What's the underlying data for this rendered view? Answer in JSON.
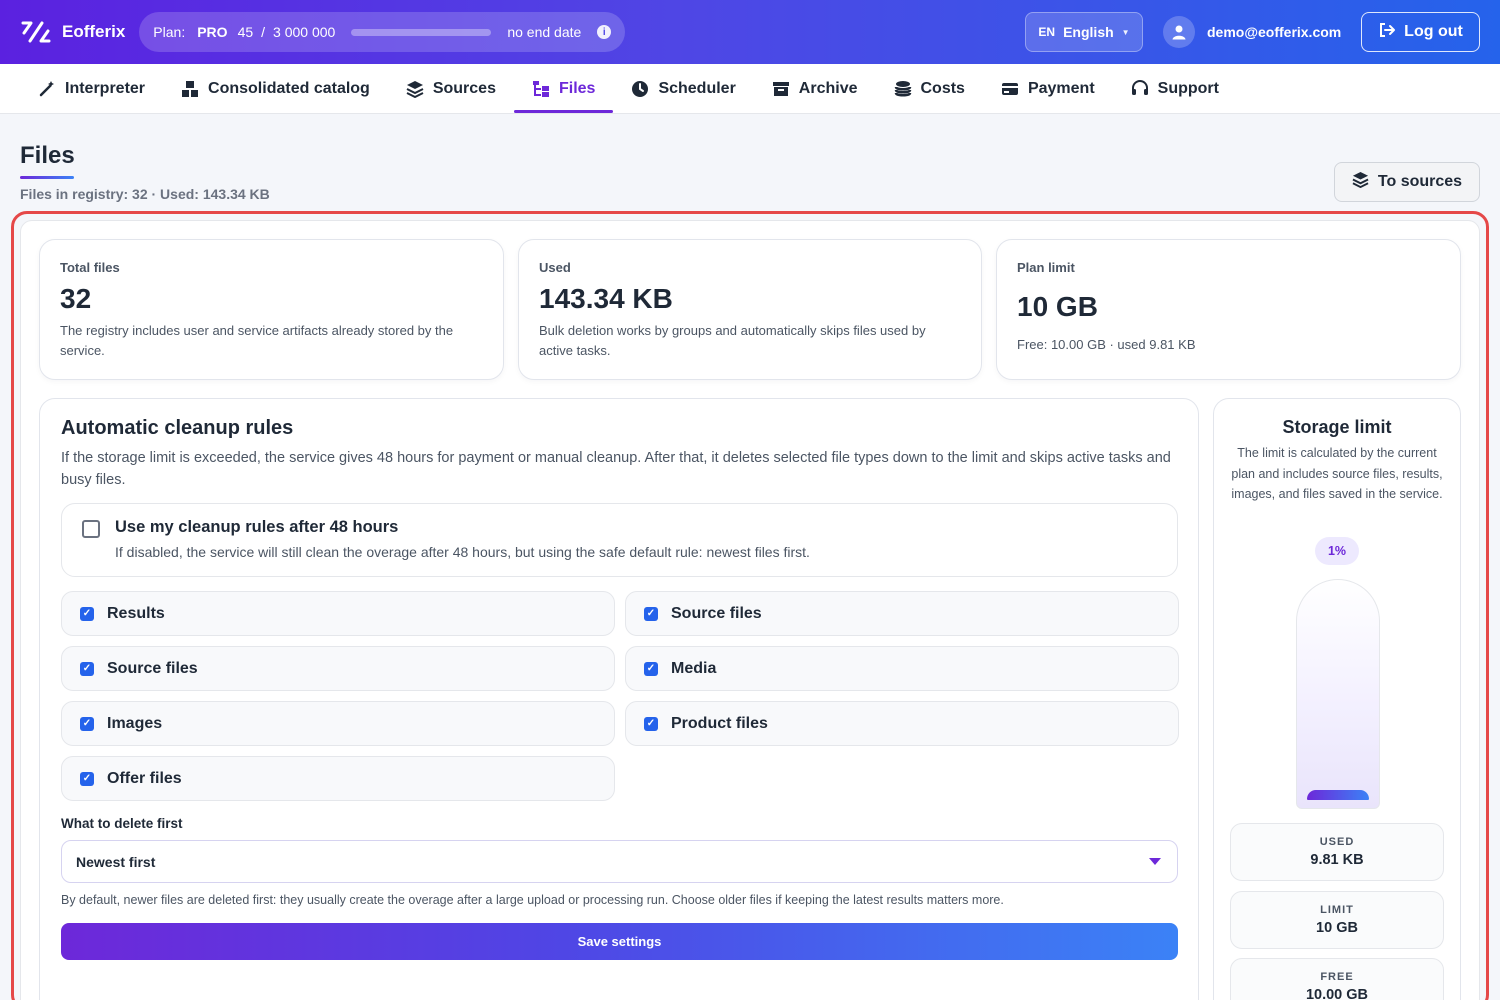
{
  "app": {
    "name": "Eofferix"
  },
  "plan": {
    "label": "Plan:",
    "tier": "PRO",
    "used": "45",
    "separator": "/",
    "limit": "3 000 000",
    "usage_fraction": 1.5e-05,
    "end": "no end date"
  },
  "language": {
    "code": "EN",
    "name": "English"
  },
  "user": {
    "email": "demo@eofferix.com"
  },
  "logout_label": "Log out",
  "nav": [
    {
      "label": "Interpreter",
      "icon": "magic-wand-icon"
    },
    {
      "label": "Consolidated catalog",
      "icon": "boxes-icon"
    },
    {
      "label": "Sources",
      "icon": "layers-icon"
    },
    {
      "label": "Files",
      "icon": "folder-tree-icon",
      "active": true
    },
    {
      "label": "Scheduler",
      "icon": "clock-icon"
    },
    {
      "label": "Archive",
      "icon": "archive-icon"
    },
    {
      "label": "Costs",
      "icon": "coins-icon"
    },
    {
      "label": "Payment",
      "icon": "credit-card-icon"
    },
    {
      "label": "Support",
      "icon": "headset-icon"
    }
  ],
  "page": {
    "title": "Files",
    "subtitle": "Files in registry: 32 · Used: 143.34 KB",
    "to_sources": "To sources"
  },
  "stats": [
    {
      "label": "Total files",
      "value": "32",
      "desc": "The registry includes user and service artifacts already stored by the service."
    },
    {
      "label": "Used",
      "value": "143.34 KB",
      "desc": "Bulk deletion works by groups and automatically skips files used by active tasks."
    },
    {
      "label": "Plan limit",
      "value": "10 GB",
      "desc": "Free: 10.00 GB · used 9.81 KB"
    }
  ],
  "cleanup": {
    "title": "Automatic cleanup rules",
    "desc": "If the storage limit is exceeded, the service gives 48 hours for payment or manual cleanup. After that, it deletes selected file types down to the limit and skips active tasks and busy files.",
    "use_rules_title": "Use my cleanup rules after 48 hours",
    "use_rules_checked": false,
    "use_rules_desc": "If disabled, the service will still clean the overage after 48 hours, but using the safe default rule: newest files first.",
    "options": [
      {
        "label": "Results",
        "checked": true
      },
      {
        "label": "Source files",
        "checked": true
      },
      {
        "label": "Source files",
        "checked": true
      },
      {
        "label": "Media",
        "checked": true
      },
      {
        "label": "Images",
        "checked": true
      },
      {
        "label": "Product files",
        "checked": true
      },
      {
        "label": "Offer files",
        "checked": true
      }
    ],
    "delete_first_label": "What to delete first",
    "delete_first_value": "Newest first",
    "hint": "By default, newer files are deleted first: they usually create the overage after a large upload or processing run. Choose older files if keeping the latest results matters more.",
    "save_label": "Save settings"
  },
  "storage": {
    "title": "Storage limit",
    "desc": "The limit is calculated by the current plan and includes source files, results, images, and files saved in the service.",
    "percent": "1%",
    "fill_fraction": 0.01,
    "used_label": "USED",
    "used_value": "9.81 KB",
    "limit_label": "LIMIT",
    "limit_value": "10 GB",
    "free_label": "FREE",
    "free_value": "10.00 GB"
  },
  "colors": {
    "accent": "#6d28d9",
    "brand_blue": "#2563eb",
    "highlight": "#e54848"
  }
}
